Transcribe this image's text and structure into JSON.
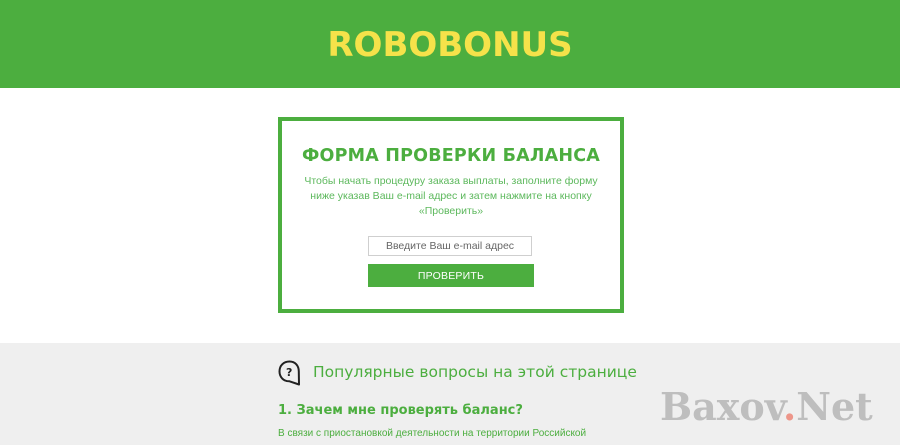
{
  "header": {
    "logo": "ROBOBONUS"
  },
  "form": {
    "title": "ФОРМА ПРОВЕРКИ БАЛАНСА",
    "description": "Чтобы начать процедуру заказа выплаты, заполните форму ниже указав Ваш e-mail адрес и затем нажмите на кнопку «Проверить»",
    "email_placeholder": "Введите Ваш e-mail адрес",
    "email_value": "",
    "button_label": "ПРОВЕРИТЬ"
  },
  "faq": {
    "title": "Популярные вопросы на этой странице",
    "icon": "question-icon",
    "items": [
      {
        "question": "1. Зачем мне проверять баланс?",
        "answer": "В связи с приостановкой деятельности на территории Российской"
      }
    ]
  },
  "watermark": {
    "left": "Baxov",
    "dot": ".",
    "right": "Net"
  },
  "colors": {
    "brand_green": "#4cae3f",
    "logo_yellow": "#f5e24a",
    "faq_background": "#efefef"
  }
}
